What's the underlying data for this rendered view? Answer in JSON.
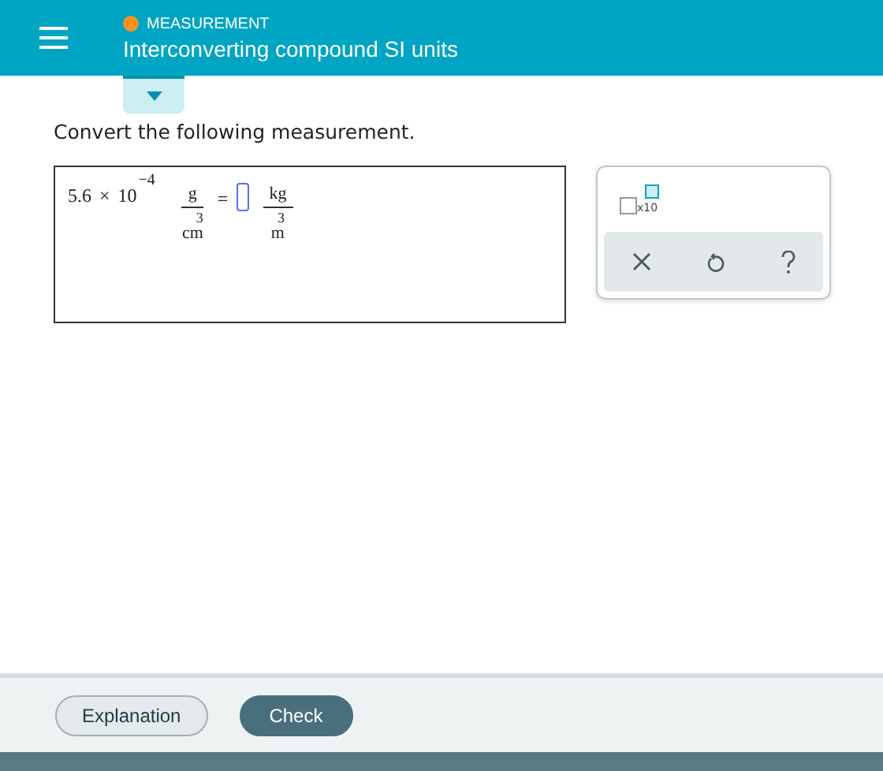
{
  "header": {
    "category": "MEASUREMENT",
    "title": "Interconverting compound SI units"
  },
  "prompt": "Convert the following measurement.",
  "equation": {
    "coefficient": "5.6",
    "times": "×",
    "base": "10",
    "exponent": "−4",
    "numerator": "g",
    "denominator": "cm",
    "denominator_exponent": "3",
    "equals": "=",
    "answer_numerator": "kg",
    "answer_denominator": "m",
    "answer_denominator_exponent": "3"
  },
  "palette": {
    "x10_label": "x10"
  },
  "buttons": [
    {
      "label": "Explanation",
      "kind": "secondary"
    },
    {
      "label": "Check",
      "kind": "primary"
    }
  ]
}
